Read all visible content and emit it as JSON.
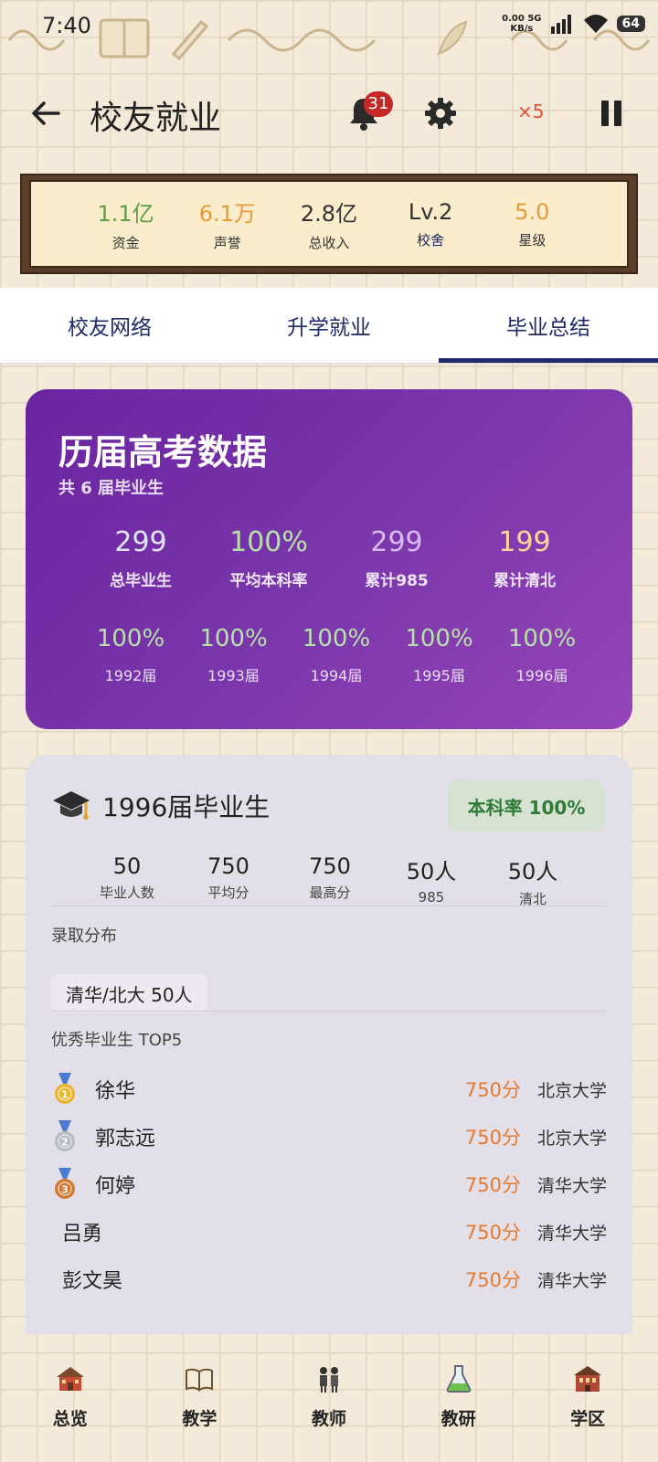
{
  "status_bar": {
    "time": "7:40",
    "net_speed_value": "0.00",
    "net_speed_unit": "KB/s",
    "network_type": "5G",
    "battery": "64"
  },
  "header": {
    "title": "校友就业",
    "notification_count": "31",
    "speed_label": "×5"
  },
  "stats": [
    {
      "value": "1.1亿",
      "label": "资金",
      "color": "#5aa043"
    },
    {
      "value": "6.1万",
      "label": "声誉",
      "color": "#e89a3a"
    },
    {
      "value": "2.8亿",
      "label": "总收入",
      "color": "#333333"
    },
    {
      "value": "Lv.2",
      "label": "校舍",
      "color": "#333333"
    },
    {
      "value": "5.0",
      "label": "星级",
      "color": "#e89a3a"
    }
  ],
  "tabs": [
    {
      "label": "校友网络",
      "active": false
    },
    {
      "label": "升学就业",
      "active": false
    },
    {
      "label": "毕业总结",
      "active": true
    }
  ],
  "summary": {
    "title": "历届高考数据",
    "subtitle": "共 6 届毕业生",
    "stats": [
      {
        "value": "299",
        "label": "总毕业生",
        "color": "#dfe6ff"
      },
      {
        "value": "100%",
        "label": "平均本科率",
        "color": "#b6e2a8"
      },
      {
        "value": "299",
        "label": "累计985",
        "color": "#d8b9f0"
      },
      {
        "value": "199",
        "label": "累计清北",
        "color": "#ffd79a"
      }
    ],
    "years": [
      {
        "value": "100%",
        "label": "1992届"
      },
      {
        "value": "100%",
        "label": "1993届"
      },
      {
        "value": "100%",
        "label": "1994届"
      },
      {
        "value": "100%",
        "label": "1995届"
      },
      {
        "value": "100%",
        "label": "1996届"
      }
    ]
  },
  "class_detail": {
    "title": "1996届毕业生",
    "rate_badge": "本科率 100%",
    "stats": [
      {
        "value": "50",
        "label": "毕业人数"
      },
      {
        "value": "750",
        "label": "平均分"
      },
      {
        "value": "750",
        "label": "最高分"
      },
      {
        "value": "50人",
        "label": "985"
      },
      {
        "value": "50人",
        "label": "清北"
      }
    ],
    "admission_label": "录取分布",
    "admission_chip": "清华/北大 50人",
    "top_label": "优秀毕业生 TOP5",
    "top_students": [
      {
        "rank": "1",
        "name": "徐华",
        "score": "750分",
        "school": "北京大学",
        "medal_color": "#e9b52b"
      },
      {
        "rank": "2",
        "name": "郭志远",
        "score": "750分",
        "school": "北京大学",
        "medal_color": "#b7bcc4"
      },
      {
        "rank": "3",
        "name": "何婷",
        "score": "750分",
        "school": "清华大学",
        "medal_color": "#d07a32"
      },
      {
        "rank": "",
        "name": "吕勇",
        "score": "750分",
        "school": "清华大学",
        "medal_color": ""
      },
      {
        "rank": "",
        "name": "彭文昊",
        "score": "750分",
        "school": "清华大学",
        "medal_color": ""
      }
    ]
  },
  "bottom_nav": [
    {
      "label": "总览",
      "icon": "school-house-icon"
    },
    {
      "label": "教学",
      "icon": "open-book-icon"
    },
    {
      "label": "教师",
      "icon": "teachers-icon"
    },
    {
      "label": "教研",
      "icon": "flask-icon"
    },
    {
      "label": "学区",
      "icon": "campus-building-icon"
    }
  ]
}
